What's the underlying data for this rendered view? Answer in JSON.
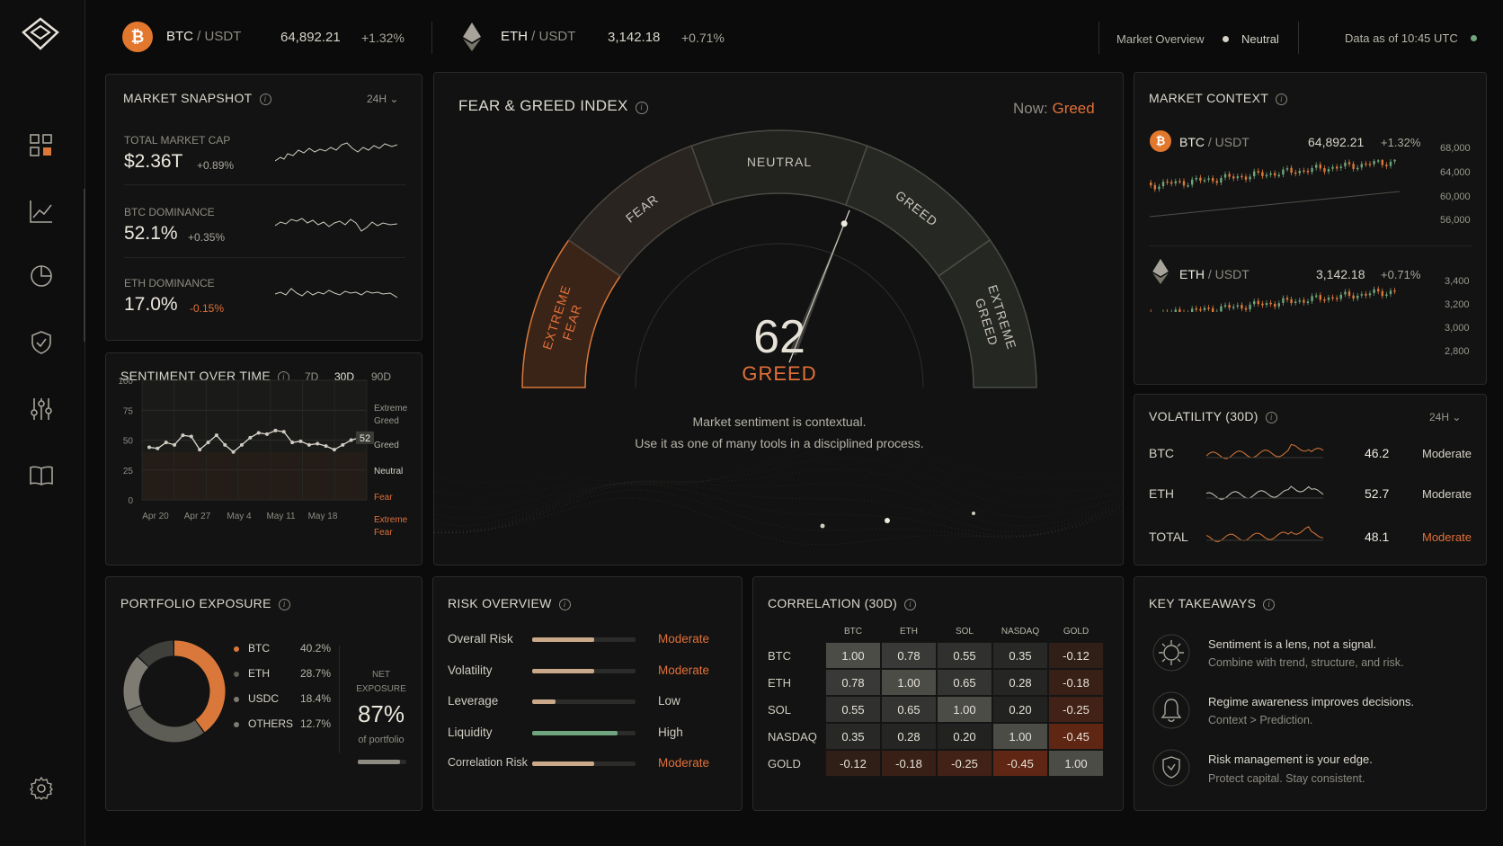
{
  "topbar": {
    "btc": {
      "symbol": "BTC",
      "quote": "/ USDT",
      "price": "64,892.21",
      "change": "+1.32%"
    },
    "eth": {
      "symbol": "ETH",
      "quote": "/ USDT",
      "price": "3,142.18",
      "change": "+0.71%"
    },
    "market_overview_label": "Market Overview",
    "market_overview_value": "Neutral",
    "data_as_of": "Data as of 10:45 UTC"
  },
  "sidebar": {
    "items": [
      "dashboard",
      "markets",
      "allocation",
      "security",
      "filters",
      "learn",
      "settings"
    ]
  },
  "snapshot": {
    "title": "MARKET SNAPSHOT",
    "range": "24H",
    "rows": [
      {
        "label": "TOTAL MARKET CAP",
        "value": "$2.36T",
        "change": "+0.89%"
      },
      {
        "label": "BTC DOMINANCE",
        "value": "52.1%",
        "change": "+0.35%"
      },
      {
        "label": "ETH DOMINANCE",
        "value": "17.0%",
        "change": "-0.15%"
      }
    ]
  },
  "sentiment": {
    "title": "SENTIMENT OVER TIME",
    "tabs": [
      "7D",
      "30D",
      "90D"
    ],
    "active_tab": "30D",
    "y_ticks": [
      "100",
      "75",
      "50",
      "25",
      "0"
    ],
    "x_ticks": [
      "Apr 20",
      "Apr 27",
      "May 4",
      "May 11",
      "May 18"
    ],
    "zones": [
      "Extreme",
      "Greed",
      "Greed",
      "Neutral",
      "Fear",
      "Extreme",
      "Fear"
    ],
    "current": "52",
    "series": [
      44,
      43,
      48,
      46,
      54,
      53,
      42,
      48,
      54,
      46,
      40,
      46,
      52,
      56,
      55,
      58,
      57,
      48,
      49,
      46,
      47,
      45,
      42,
      46,
      50,
      52
    ]
  },
  "gauge": {
    "title": "FEAR & GREED INDEX",
    "now_label": "Now:",
    "now_value": "Greed",
    "value": 62,
    "value_text": "62",
    "label": "GREED",
    "segments": [
      "EXTREME FEAR",
      "FEAR",
      "NEUTRAL",
      "GREED",
      "EXTREME GREED"
    ],
    "note_1": "Market sentiment is contextual.",
    "note_2": "Use it as one of many tools in a disciplined process."
  },
  "context": {
    "title": "MARKET CONTEXT",
    "btc": {
      "symbol": "BTC",
      "quote": "/ USDT",
      "price": "64,892.21",
      "change": "+1.32%",
      "y_ticks": [
        "68,000",
        "64,000",
        "60,000",
        "56,000"
      ]
    },
    "eth": {
      "symbol": "ETH",
      "quote": "/ USDT",
      "price": "3,142.18",
      "change": "+0.71%",
      "y_ticks": [
        "3,400",
        "3,200",
        "3,000",
        "2,800"
      ]
    }
  },
  "volatility": {
    "title": "VOLATILITY (30D)",
    "range": "24H",
    "rows": [
      {
        "asset": "BTC",
        "value": "46.2",
        "level": "Moderate"
      },
      {
        "asset": "ETH",
        "value": "52.7",
        "level": "Moderate"
      },
      {
        "asset": "TOTAL",
        "value": "48.1",
        "level": "Moderate"
      }
    ]
  },
  "portfolio": {
    "title": "PORTFOLIO EXPOSURE",
    "slices": [
      {
        "name": "BTC",
        "pct": "40.2%",
        "value": 40.2,
        "color": "#d9783a"
      },
      {
        "name": "ETH",
        "pct": "28.7%",
        "value": 28.7,
        "color": "#5d5c55"
      },
      {
        "name": "USDC",
        "pct": "18.4%",
        "value": 18.4,
        "color": "#7d7b72"
      },
      {
        "name": "OTHERS",
        "pct": "12.7%",
        "value": 12.7,
        "color": "#3f403b"
      }
    ],
    "net_label_1": "NET",
    "net_label_2": "EXPOSURE",
    "net_value": "87%",
    "net_sub": "of portfolio",
    "net_fraction": 0.87
  },
  "risk": {
    "title": "RISK OVERVIEW",
    "rows": [
      {
        "label": "Overall Risk",
        "level": "Moderate",
        "fill": 0.6,
        "color": "#c9a98a",
        "tone": "orange"
      },
      {
        "label": "Volatility",
        "level": "Moderate",
        "fill": 0.6,
        "color": "#c9a98a",
        "tone": "orange"
      },
      {
        "label": "Leverage",
        "level": "Low",
        "fill": 0.23,
        "color": "#c9a98a",
        "tone": "plain"
      },
      {
        "label": "Liquidity",
        "level": "High",
        "fill": 0.83,
        "color": "#6fa57e",
        "tone": "plain"
      },
      {
        "label": "Correlation Risk",
        "level": "Moderate",
        "fill": 0.6,
        "color": "#c9a98a",
        "tone": "orange"
      }
    ]
  },
  "correlation": {
    "title": "CORRELATION (30D)",
    "labels": [
      "BTC",
      "ETH",
      "SOL",
      "NASDAQ",
      "GOLD"
    ],
    "matrix": [
      [
        "1.00",
        "0.78",
        "0.55",
        "0.35",
        "-0.12"
      ],
      [
        "0.78",
        "1.00",
        "0.65",
        "0.28",
        "-0.18"
      ],
      [
        "0.55",
        "0.65",
        "1.00",
        "0.20",
        "-0.25"
      ],
      [
        "0.35",
        "0.28",
        "0.20",
        "1.00",
        "-0.45"
      ],
      [
        "-0.12",
        "-0.18",
        "-0.25",
        "-0.45",
        "1.00"
      ]
    ]
  },
  "takeaways": {
    "title": "KEY TAKEAWAYS",
    "items": [
      {
        "line1": "Sentiment is a lens, not a signal.",
        "line2": "Combine with trend, structure, and risk.",
        "icon": "compass-icon"
      },
      {
        "line1": "Regime awareness improves decisions.",
        "line2": "Context > Prediction.",
        "icon": "bell-icon"
      },
      {
        "line1": "Risk management is your edge.",
        "line2": "Protect capital. Stay consistent.",
        "icon": "shield-icon"
      }
    ]
  },
  "colors": {
    "accent": "#e2703a",
    "green": "#6fa57e",
    "panel": "#121312"
  }
}
